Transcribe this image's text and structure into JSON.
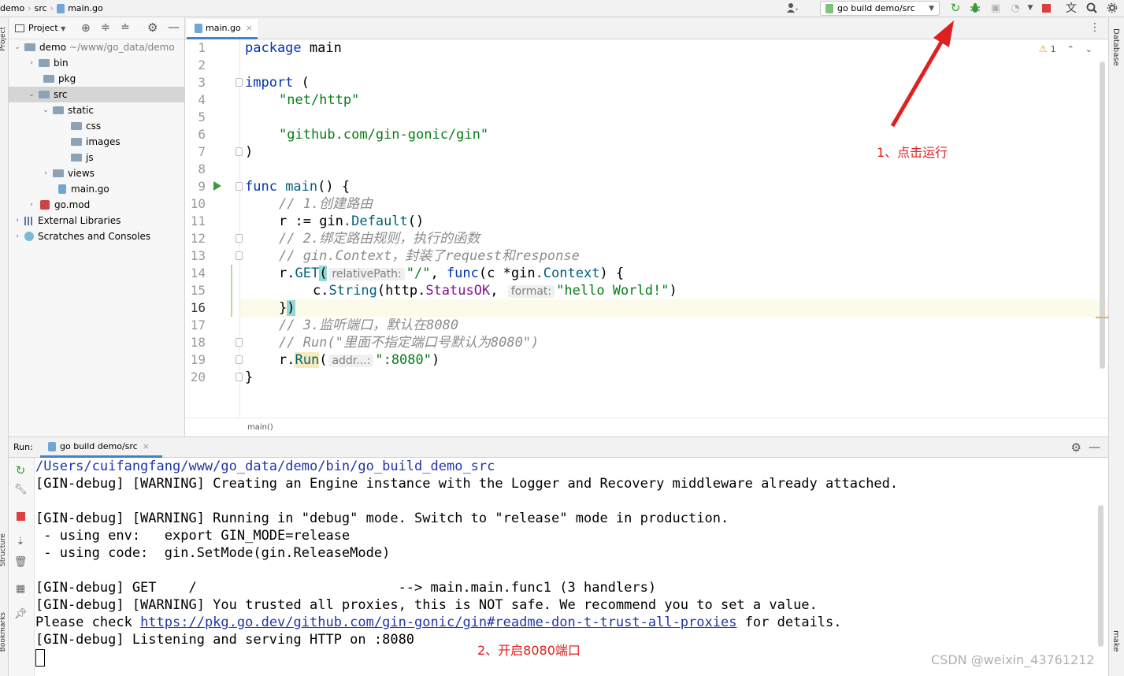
{
  "breadcrumb": [
    "demo",
    "src",
    "main.go"
  ],
  "toolbar": {
    "run_config": "go build demo/src",
    "icons": [
      "user-icon",
      "rerun-icon",
      "debug-icon",
      "coverage-icon",
      "profile-icon",
      "stop-icon",
      "translate-icon",
      "search-icon"
    ]
  },
  "left_strip": {
    "project_label": "Project",
    "structure_label": "Structure",
    "bookmarks_label": "Bookmarks"
  },
  "right_strip": {
    "database_label": "Database",
    "make_label": "make"
  },
  "project_panel": {
    "title": "Project",
    "tree": [
      {
        "label": "demo",
        "sub": "~/www/go_data/demo",
        "type": "folder",
        "expanded": true
      },
      {
        "label": "bin",
        "type": "folder"
      },
      {
        "label": "pkg",
        "type": "folder"
      },
      {
        "label": "src",
        "type": "folder",
        "expanded": true,
        "selected": true
      },
      {
        "label": "static",
        "type": "folder",
        "expanded": true
      },
      {
        "label": "css",
        "type": "folder"
      },
      {
        "label": "images",
        "type": "folder"
      },
      {
        "label": "js",
        "type": "folder"
      },
      {
        "label": "views",
        "type": "folder"
      },
      {
        "label": "main.go",
        "type": "gofile"
      },
      {
        "label": "go.mod",
        "type": "mod"
      },
      {
        "label": "External Libraries",
        "type": "lib"
      },
      {
        "label": "Scratches and Consoles",
        "type": "scratch"
      }
    ]
  },
  "editor": {
    "tab": "main.go",
    "warning_count": "1",
    "status": "main()",
    "line_numbers": [
      "1",
      "2",
      "3",
      "4",
      "5",
      "6",
      "7",
      "8",
      "9",
      "10",
      "11",
      "12",
      "13",
      "14",
      "15",
      "16",
      "17",
      "18",
      "19",
      "20"
    ],
    "lines": {
      "l1_kw": "package",
      "l1_name": " main",
      "l3_kw": "import",
      "l3_rest": " (",
      "l4": "\"net/http\"",
      "l6": "\"github.com/gin-gonic/gin\"",
      "l7": ")",
      "l9_kw": "func",
      "l9_name": " main",
      "l9_rest": "() {",
      "l10": "// 1.创建路由",
      "l11_a": "r := ",
      "l11_pkg": "gin",
      "l11_fn": ".Default",
      "l11_b": "()",
      "l12": "// 2.绑定路由规则，执行的函数",
      "l13": "// gin.Context，封装了request和response",
      "l14_a": "r.",
      "l14_fn": "GET",
      "l14_paren": "(",
      "l14_hint": "relativePath:",
      "l14_str": "\"/\"",
      "l14_b": ", ",
      "l14_kw": "func",
      "l14_c": "(c *",
      "l14_pkg": "gin",
      "l14_type": ".Context",
      "l14_d": ") {",
      "l15_a": "c.",
      "l15_fn": "String",
      "l15_b": "(http.",
      "l15_const": "StatusOK",
      "l15_c": ", ",
      "l15_hint": "format:",
      "l15_str": "\"hello World!\"",
      "l15_d": ")",
      "l16_a": "}",
      "l16_paren": ")",
      "l17": "// 3.监听端口，默认在8080",
      "l18": "// Run(\"里面不指定端口号默认为8080\")",
      "l19_a": "r.",
      "l19_fn": "Run",
      "l19_b": "(",
      "l19_hint": "addr...:",
      "l19_str": "\":8080\"",
      "l19_c": ")",
      "l20": "}"
    }
  },
  "run_panel": {
    "label": "Run:",
    "tab": "go build demo/src",
    "console": [
      "/Users/cuifangfang/www/go_data/demo/bin/go_build_demo_src",
      "[GIN-debug] [WARNING] Creating an Engine instance with the Logger and Recovery middleware already attached.",
      "",
      "[GIN-debug] [WARNING] Running in \"debug\" mode. Switch to \"release\" mode in production.",
      " - using env:   export GIN_MODE=release",
      " - using code:  gin.SetMode(gin.ReleaseMode)",
      "",
      "[GIN-debug] GET    /                         --> main.main.func1 (3 handlers)",
      "[GIN-debug] [WARNING] You trusted all proxies, this is NOT safe. We recommend you to set a value.",
      "Please check ",
      "[GIN-debug] Listening and serving HTTP on :8080"
    ],
    "link_text": "https://pkg.go.dev/github.com/gin-gonic/gin#readme-don-t-trust-all-proxies",
    "link_suffix": " for details."
  },
  "annotations": {
    "step1": "1、点击运行",
    "step2": "2、开启8080端口"
  },
  "watermark": "CSDN @weixin_43761212",
  "colors": {
    "keyword": "#0033b3",
    "string": "#067d17",
    "comment": "#8c8c8c",
    "accent": "#e02020",
    "link": "#2036a8"
  }
}
